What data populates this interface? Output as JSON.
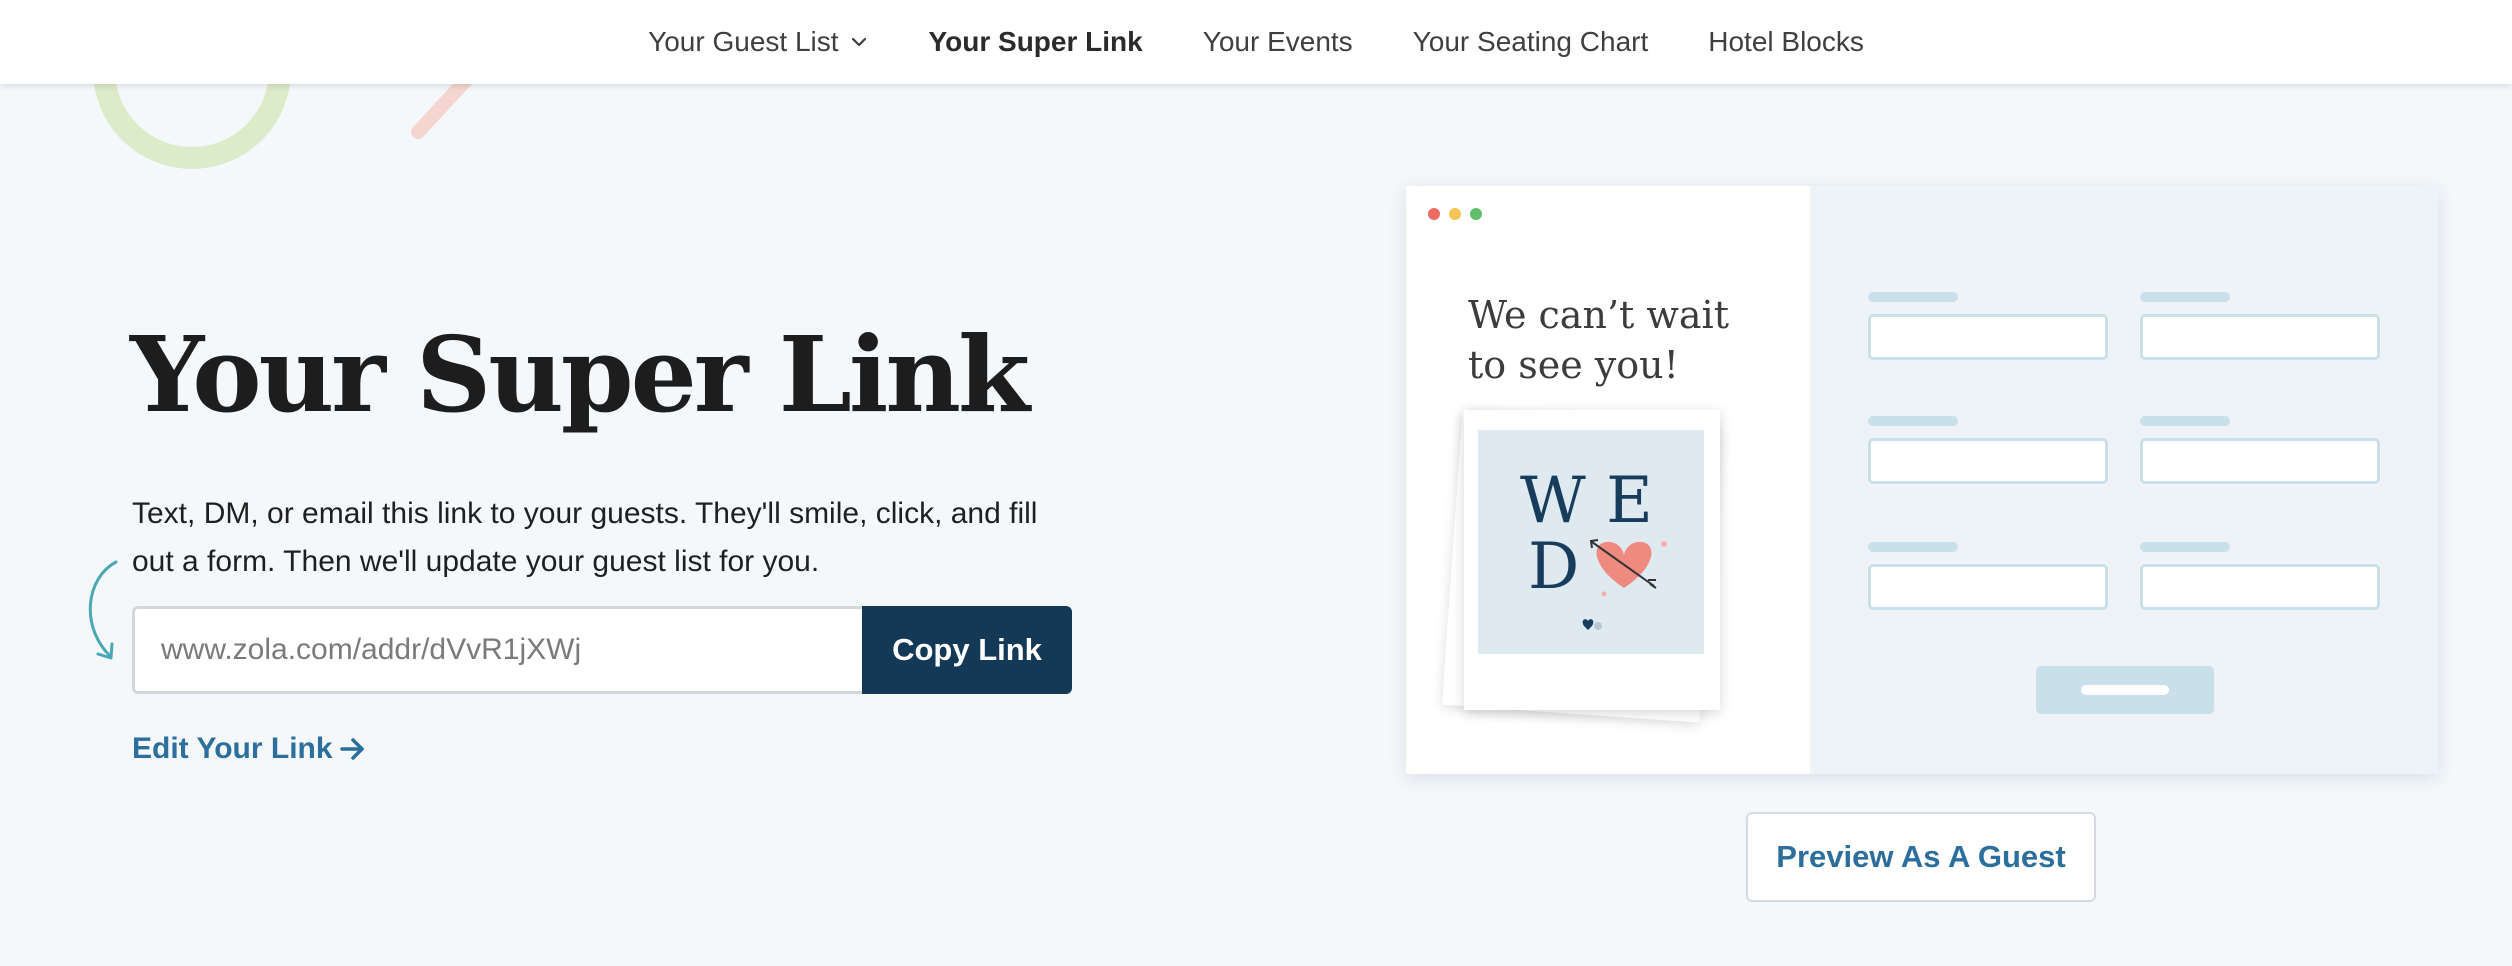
{
  "nav": {
    "items": [
      {
        "label": "Your Guest List",
        "has_dropdown": true,
        "active": false
      },
      {
        "label": "Your Super Link",
        "has_dropdown": false,
        "active": true
      },
      {
        "label": "Your Events",
        "has_dropdown": false,
        "active": false
      },
      {
        "label": "Your Seating Chart",
        "has_dropdown": false,
        "active": false
      },
      {
        "label": "Hotel Blocks",
        "has_dropdown": false,
        "active": false
      }
    ]
  },
  "hero": {
    "title": "Your Super Link",
    "description": "Text, DM, or email this link to your guests. They'll smile, click, and fill out a form. Then we'll update your guest list for you.",
    "link_value": "www.zola.com/addr/dVvR1jXWj",
    "copy_label": "Copy Link",
    "edit_label": "Edit Your Link"
  },
  "preview": {
    "headline": "We can’t wait to see you!",
    "card_letters_top": "W E",
    "card_letters_bottom": "D",
    "preview_button_label": "Preview As A Guest"
  },
  "icons": {
    "dropdown": "chevron-down-icon",
    "edit_arrow": "arrow-right-icon",
    "curve": "curved-arrow-icon",
    "heart": "heart-arrow-icon"
  },
  "colors": {
    "accent_navy": "#133957",
    "link_blue": "#2c6e9c",
    "background": "#f4f8fb",
    "mock_field": "#c9dfe9",
    "heart": "#ee8a80",
    "dot_red": "#ee6b61",
    "dot_yellow": "#f2c554",
    "dot_green": "#5fbf6a"
  }
}
